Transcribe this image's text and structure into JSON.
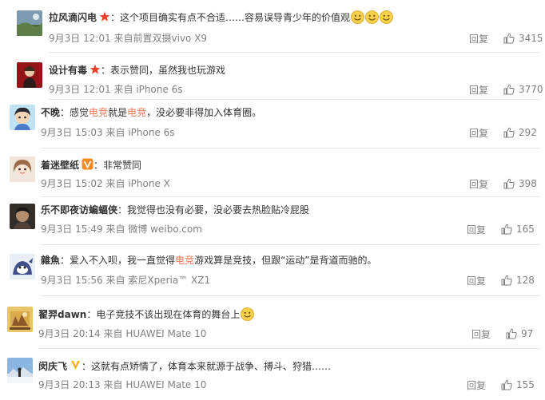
{
  "comments": [
    {
      "username": "拉风滴闪电",
      "badge": "star",
      "separator": "：",
      "text": "这个项目确实有点不合适……容易误导青少年的价值观",
      "emoji_count": 3,
      "date": "9月3日 12:01",
      "source_prefix": "来自",
      "source": "前置双摄vivo X9",
      "reply_label": "回复",
      "likes": "3415"
    },
    {
      "username": "设计有毒",
      "badge": "star",
      "separator": "：",
      "text": "表示赞同，虽然我也玩游戏",
      "date": "9月3日 12:01",
      "source_prefix": "来自",
      "source": "iPhone 6s",
      "reply_label": "回复",
      "likes": "3770"
    },
    {
      "username": "不晚",
      "separator": "：",
      "text_parts": [
        "感觉",
        "电竞",
        "就是",
        "电竞",
        "，没必要非得加入体育圈。"
      ],
      "date": "9月3日 15:03",
      "source_prefix": "来自",
      "source": "iPhone 6s",
      "reply_label": "回复",
      "likes": "292"
    },
    {
      "username": "着迷壁纸",
      "badge": "v-orange",
      "separator": "：",
      "text": "非常赞同",
      "date": "9月3日 15:02",
      "source_prefix": "来自",
      "source": "iPhone X",
      "reply_label": "回复",
      "likes": "398"
    },
    {
      "username": "乐不即夜访蝙蝠侠",
      "separator": "：",
      "text": "我觉得也没有必要，没必要去热脸贴冷屁股",
      "date": "9月3日 15:49",
      "source_prefix": "来自",
      "source": "微博 weibo.com",
      "reply_label": "回复",
      "likes": "165"
    },
    {
      "username": "雜魚",
      "separator": "：",
      "text_parts": [
        "爱入不入呗，我一直觉得",
        "电竞",
        "游戏算是竞技，但跟“运动”是背道而驰的。"
      ],
      "date": "9月3日 15:56",
      "source_prefix": "来自",
      "source": "索尼Xperia™ XZ1",
      "reply_label": "回复",
      "likes": "128"
    },
    {
      "username": "翟羿dawn",
      "separator": "：",
      "text": "电子竞技不该出现在体育的舞台上",
      "emoji_count": 1,
      "date": "9月3日 20:14",
      "source_prefix": "来自",
      "source": "HUAWEI Mate 10",
      "reply_label": "回复",
      "likes": "97"
    },
    {
      "username": "闵庆飞",
      "badge": "v-yellow",
      "separator": "：",
      "text": "这就有点矫情了，体育本来就源于战争、搏斗、狩猎……",
      "date": "9月3日 20:13",
      "source_prefix": "来自",
      "source": "HUAWEI Mate 10",
      "reply_label": "回复",
      "likes": "155"
    }
  ],
  "colors": {
    "highlight": "#eb7350",
    "meta": "#808080",
    "star": "#e8412c",
    "v_orange": "#f68a1f",
    "v_yellow": "#f5b300"
  }
}
